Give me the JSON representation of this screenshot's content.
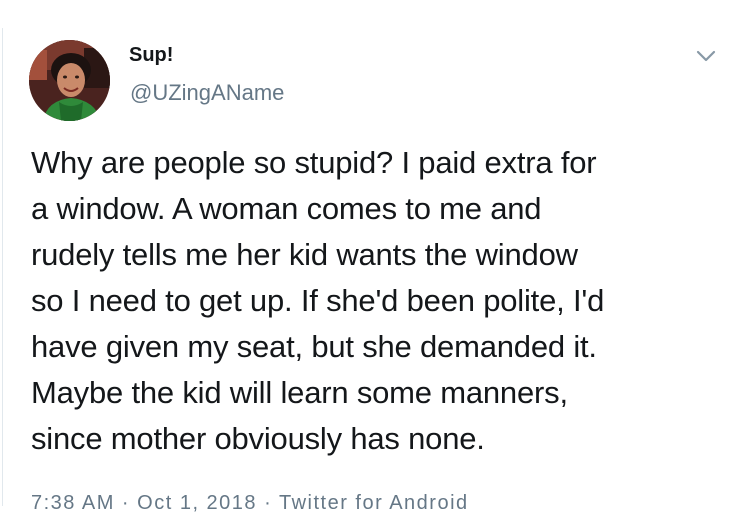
{
  "tweet": {
    "display_name": "Sup!",
    "handle": "@UZingAName",
    "lines": [
      "Why are people so stupid? I paid extra for",
      "a window. A woman comes to me and",
      "rudely tells me her kid wants the window",
      "so I need to get up. If she'd been polite, I'd",
      "have given my seat, but she demanded it.",
      "Maybe the kid will learn some manners,",
      "since mother obviously has none."
    ],
    "meta_partial": "7:38 AM · Oct 1, 2018 · Twitter for Android"
  },
  "icons": {
    "avatar": "profile-photo",
    "caret": "chevron-down-icon"
  },
  "colors": {
    "text": "#14171a",
    "secondary": "#657786",
    "background": "#ffffff",
    "divider": "#e1e8ed"
  }
}
